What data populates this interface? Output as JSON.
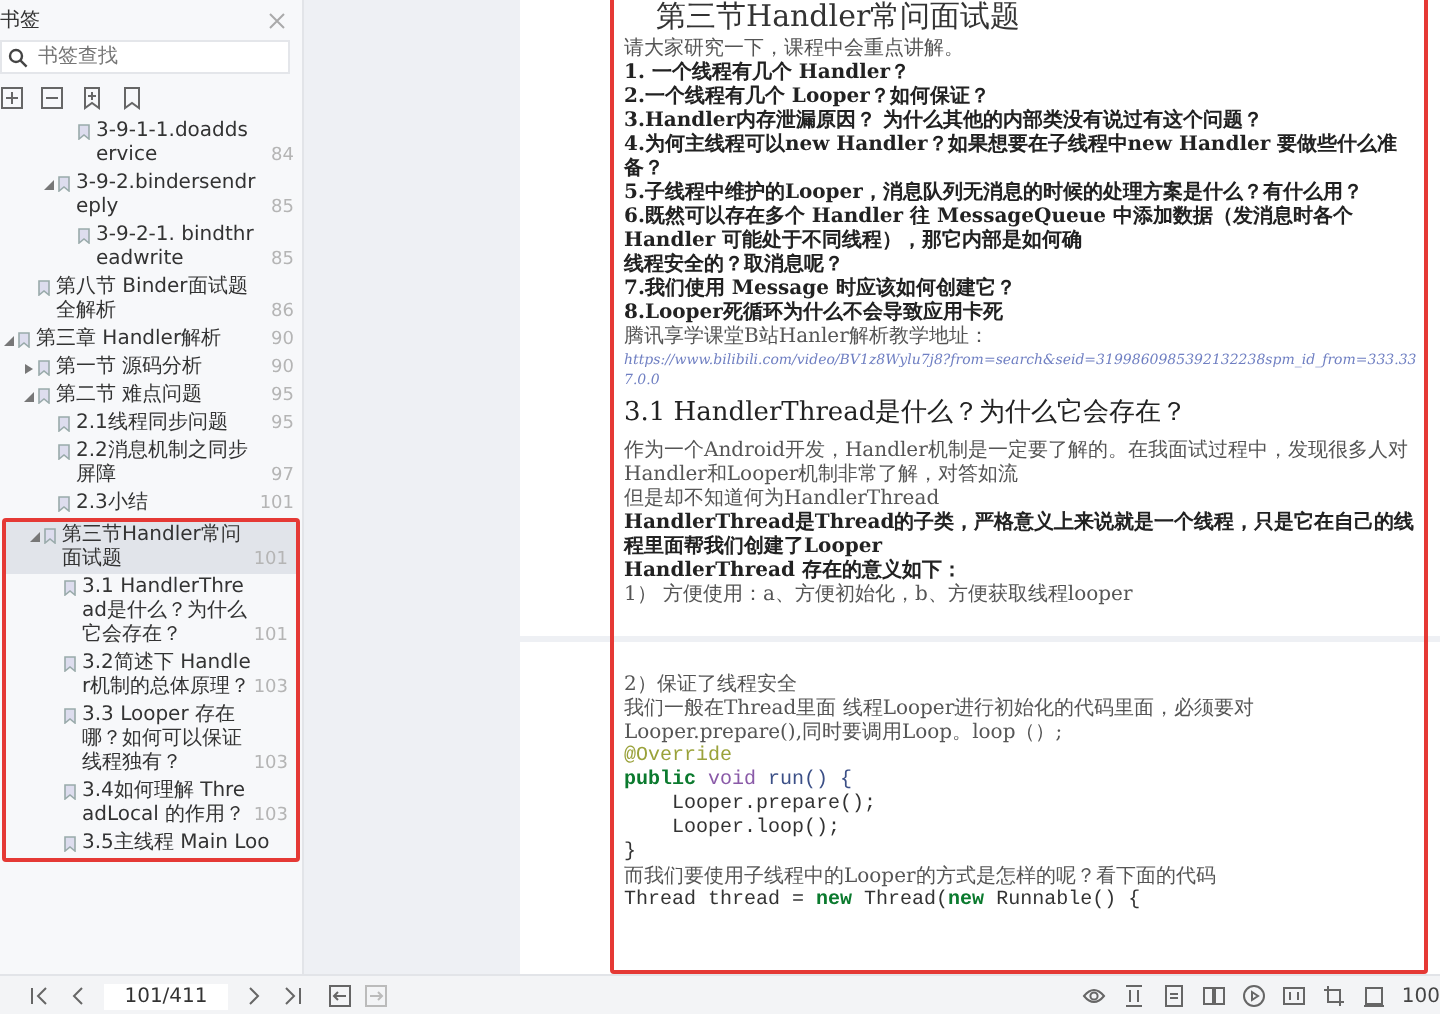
{
  "sidebar": {
    "title": "书签",
    "search": {
      "placeholder": "书签查找"
    },
    "tree": [
      {
        "children": [
          {
            "children": [
              {
                "children": [
                  {
                    "label": "3-9-1-1.doaddservice",
                    "page": "84"
                  }
                ]
              },
              {
                "label": "3-9-2.bindersendreply",
                "page": "85",
                "expanded": true,
                "children": [
                  {
                    "label": "3-9-2-1. bindthreadwrite",
                    "page": "85"
                  }
                ]
              }
            ]
          },
          {
            "label": "第八节 Binder面试题全解析",
            "page": "86"
          }
        ]
      },
      {
        "label": "第三章 Handler解析",
        "page": "90",
        "expanded": true,
        "children": [
          {
            "label": "第一节 源码分析",
            "page": "90",
            "expanded": false
          },
          {
            "label": "第二节 难点问题",
            "page": "95",
            "expanded": true,
            "children": [
              {
                "label": "2.1线程同步问题",
                "page": "95"
              },
              {
                "label": "2.2消息机制之同步屏障",
                "page": "97"
              },
              {
                "label": "2.3小结",
                "page": "101"
              }
            ]
          },
          {
            "label": "第三节Handler常问面试题",
            "page": "101",
            "expanded": true,
            "selected": true,
            "children": [
              {
                "label": "3.1 HandlerThread是什么？为什么它会存在？",
                "page": "101"
              },
              {
                "label": "3.2简述下 Handler机制的总体原理？",
                "page": "103"
              },
              {
                "label": "3.3 Looper 存在哪？如何可以保证线程独有？",
                "page": "103"
              },
              {
                "label": "3.4如何理解 ThreadLocal 的作用？",
                "page": "103"
              },
              {
                "label": "3.5主线程 Main Loo"
              }
            ]
          }
        ]
      }
    ],
    "page_indicator": "101/411"
  },
  "pages": [
    {
      "blocks": [
        {
          "kind": "title",
          "text": "第三节Handler常问面试题"
        },
        {
          "kind": "text",
          "text": "请大家研究一下，课程中会重点讲解。"
        },
        {
          "kind": "bold",
          "text": "1. 一个线程有几个 Handler？"
        },
        {
          "kind": "bold",
          "text": "2.一个线程有几个 Looper？如何保证？"
        },
        {
          "kind": "bold",
          "text": "3.Handler内存泄漏原因？ 为什么其他的内部类没有说过有这个问题？"
        },
        {
          "kind": "bold",
          "text": "4.为何主线程可以new Handler？如果想要在子线程中new Handler 要做些什么准备？"
        },
        {
          "kind": "bold",
          "text": "5.子线程中维护的Looper，消息队列无消息的时候的处理方案是什么？有什么用？"
        },
        {
          "kind": "bold",
          "text": "6.既然可以存在多个 Handler 往 MessageQueue 中添加数据（发消息时各个 Handler 可能处于不同线程），那它内部是如何确"
        },
        {
          "kind": "bold",
          "text": "线程安全的？取消息呢？"
        },
        {
          "kind": "bold",
          "text": "7.我们使用 Message 时应该如何创建它？"
        },
        {
          "kind": "bold",
          "text": "8.Looper死循环为什么不会导致应用卡死"
        },
        {
          "kind": "text",
          "text": "腾讯享学课堂B站Hanler解析教学地址："
        },
        {
          "kind": "link",
          "text": "https://www.bilibili.com/video/BV1z8Wylu7j8?from=search&seid=3199860985392132238spm_id_from=333.337.0.0"
        },
        {
          "kind": "heading",
          "text": "3.1 HandlerThread是什么？为什么它会存在？"
        },
        {
          "kind": "text",
          "text": "作为一个Android开发，Handler机制是一定要了解的。在我面试过程中，发现很多人对Handler和Looper机制非常了解，对答如流"
        },
        {
          "kind": "text",
          "text": "但是却不知道何为HandlerThread"
        },
        {
          "kind": "bold",
          "text": "HandlerThread是Thread的子类，严格意义上来说就是一个线程，只是它在自己的线程里面帮我们创建了Looper"
        },
        {
          "kind": "bold",
          "text": "HandlerThread 存在的意义如下："
        },
        {
          "kind": "text",
          "text": "1） 方便使用：a、方便初始化，b、方便获取线程looper"
        }
      ]
    },
    {
      "blocks": [
        {
          "kind": "text",
          "text": "2）保证了线程安全"
        },
        {
          "kind": "text",
          "text": "我们一般在Thread里面 线程Looper进行初始化的代码里面，必须要对Looper.prepare(),同时要调用Loop。loop（）;"
        },
        {
          "kind": "code",
          "tokens": [
            {
              "kind": "annotation",
              "text": "@Override"
            }
          ]
        },
        {
          "kind": "code",
          "tokens": [
            {
              "kind": "keyword",
              "text": "public"
            },
            {
              "kind": "type",
              "text": " void"
            },
            {
              "kind": "method",
              "text": " run() {"
            }
          ]
        },
        {
          "kind": "code",
          "tokens": [
            {
              "kind": "plain",
              "text": "    Looper.prepare();"
            }
          ]
        },
        {
          "kind": "code",
          "tokens": [
            {
              "kind": "plain",
              "text": "    Looper.loop();"
            }
          ]
        },
        {
          "kind": "code",
          "tokens": [
            {
              "kind": "plain",
              "text": "}"
            }
          ]
        },
        {
          "kind": "text",
          "text": "而我们要使用子线程中的Looper的方式是怎样的呢？看下面的代码"
        },
        {
          "kind": "code",
          "tokens": [
            {
              "kind": "plain",
              "text": "Thread thread = "
            },
            {
              "kind": "keyword",
              "text": "new"
            },
            {
              "kind": "plain",
              "text": " Thread("
            },
            {
              "kind": "keyword",
              "text": "new"
            },
            {
              "kind": "plain",
              "text": " Runnable() {"
            }
          ]
        }
      ]
    }
  ],
  "status_bar": {
    "zoom": "100"
  }
}
